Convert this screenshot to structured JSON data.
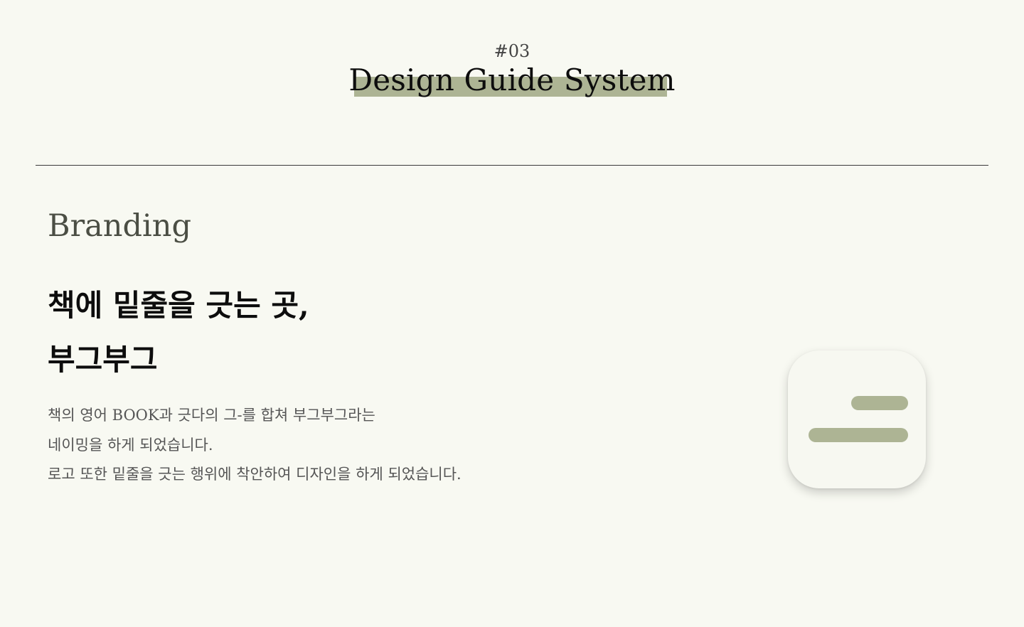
{
  "header": {
    "section_number": "#03",
    "title": "Design Guide System"
  },
  "branding": {
    "heading": "Branding",
    "headline": [
      "책에 밑줄을 긋는 곳,",
      "부그부그"
    ],
    "description": [
      "책의 영어 BOOK과 긋다의 그-를 합쳐 부그부그라는",
      "네이밍을 하게 되었습니다.",
      "로고 또한 밑줄을 긋는 행위에 착안하여 디자인을 하게 되었습니다."
    ]
  },
  "logo": {
    "icon": "underline-logo-icon",
    "bar_color": "#adb494",
    "background_color": "#f7f8f1"
  },
  "colors": {
    "accent": "#adb494",
    "background": "#f8f9f2"
  }
}
